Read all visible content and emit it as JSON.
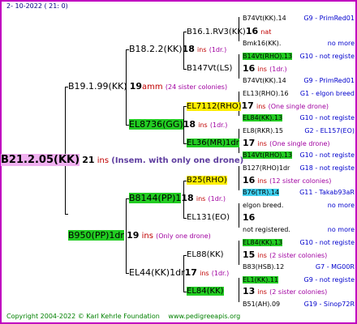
{
  "header": {
    "date": "2- 10-2022 ( 21: 0)"
  },
  "root": {
    "id": "B21.2.05(KK)",
    "count": "21",
    "ins": "ins",
    "notes": "(Insem. with only one drone)"
  },
  "gen1": {
    "upper": {
      "id": "B19.1.99(KK)",
      "count": "19",
      "ins": "amm",
      "notes": "(24 sister colonies)"
    },
    "lower": {
      "id": "B950(PP)1dr",
      "count": "19",
      "ins": "ins",
      "notes": "(Only one drone)"
    }
  },
  "gen2": [
    {
      "id": "B18.2.2(KK)",
      "count": "18",
      "ins": "ins",
      "notes": "(1dr.)"
    },
    {
      "id": "EL8736(GG)",
      "count": "18",
      "ins": "ins",
      "notes": "(1dr.)"
    },
    {
      "id": "B8144(PP)1",
      "count": "18",
      "ins": "ins",
      "notes": "(1dr.)"
    },
    {
      "id": "EL44(KK)1dr",
      "count": "17",
      "ins": "ins",
      "notes": "(1dr.)"
    }
  ],
  "gen3": [
    {
      "id": "B16.1.RV3(KK)",
      "count": "16",
      "ins": "nat"
    },
    {
      "id": "B147Vt(LS)",
      "count": "16",
      "ins": "ins",
      "notes": "(1dr.)"
    },
    {
      "id": "EL7112(RHO)",
      "count": "17",
      "ins": "ins",
      "notes": "(One single drone)"
    },
    {
      "id": "EL36(MR)1dr",
      "count": "17",
      "ins": "ins",
      "notes": "(One single drone)"
    },
    {
      "id": "B25(RHO)",
      "count": "16",
      "ins": "ins",
      "notes": "(12 sister colonies)"
    },
    {
      "id": "EL131(EO)",
      "count": "16",
      "ins": "",
      "notes": ""
    },
    {
      "id": "EL88(KK)",
      "count": "15",
      "ins": "ins",
      "notes": "(2 sister colonies)"
    },
    {
      "id": "EL84(KK)",
      "count": "13",
      "ins": "ins",
      "notes": "(2 sister colonies)"
    }
  ],
  "gen4": [
    {
      "id": "B74Vt(KK).14",
      "info": "G9 - PrimRed01"
    },
    {
      "id": "Bmk16(KK).",
      "info": "no more"
    },
    {
      "id": "B14Vt(RHO).13",
      "info": "G10 - not registe"
    },
    {
      "id": "B74Vt(KK).14",
      "info": "G9 - PrimRed01"
    },
    {
      "id": "EL13(RHO).16",
      "info": "G1 - elgon breed"
    },
    {
      "id": "EL84(KK).13",
      "info": "G10 - not registe"
    },
    {
      "id": "EL8(RKR).15",
      "info": "G2 - EL157(EO)"
    },
    {
      "id": "B14Vt(RHO).13",
      "info": "G10 - not registe"
    },
    {
      "id": "B127(RHO)1dr",
      "info": "G18 - not registe"
    },
    {
      "id": "B76(TR).14",
      "info": "G11 - Takab93aR"
    },
    {
      "id": "elgon breed.",
      "info": "no more"
    },
    {
      "id": "not registered.",
      "info": "no more"
    },
    {
      "id": "EL84(KK).13",
      "info": "G10 - not registe"
    },
    {
      "id": "B83(HSB).12",
      "info": "G7 - MG00R"
    },
    {
      "id": "EL1(KK).11",
      "info": "G9 - not registe"
    },
    {
      "id": "B51(AH).09",
      "info": "G19 - Sinop72R"
    }
  ],
  "footer": {
    "copyright": "Copyright 2004-2022 © Karl Kehrle Foundation",
    "url": "www.pedigreeapis.org"
  }
}
